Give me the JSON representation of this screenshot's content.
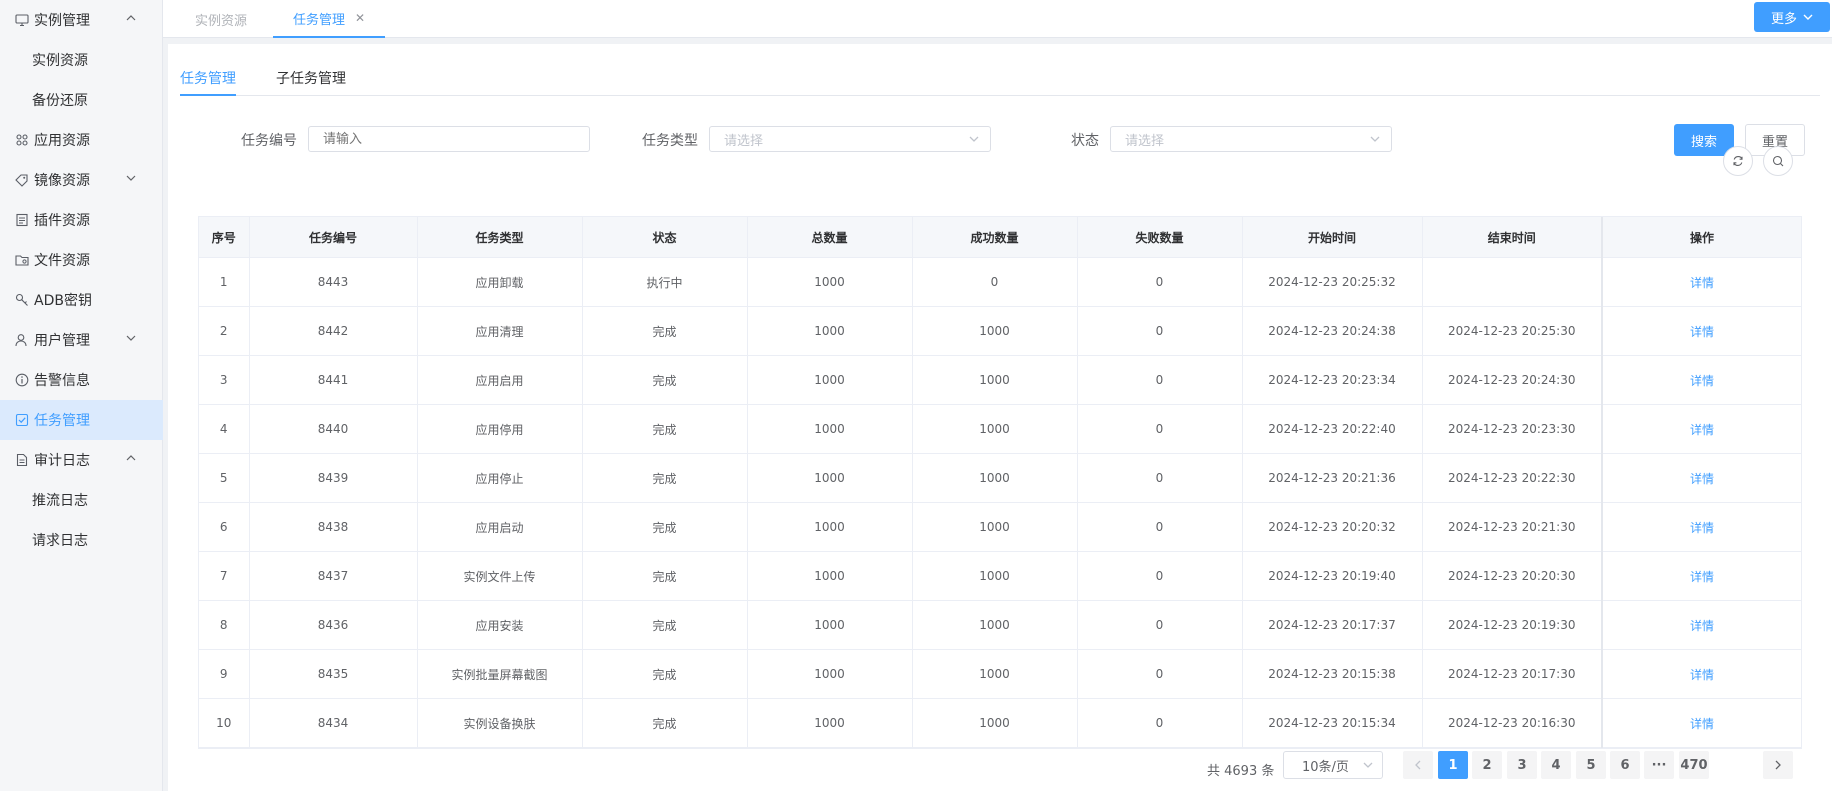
{
  "sidebar": {
    "items": [
      {
        "label": "实例管理",
        "level": "top",
        "icon": "monitor-icon",
        "arrow": "up"
      },
      {
        "label": "实例资源",
        "level": "sub"
      },
      {
        "label": "备份还原",
        "level": "sub"
      },
      {
        "label": "应用资源",
        "level": "top",
        "icon": "apps-grid-icon"
      },
      {
        "label": "镜像资源",
        "level": "top",
        "icon": "tag-icon",
        "arrow": "down"
      },
      {
        "label": "插件资源",
        "level": "top",
        "icon": "document-list-icon"
      },
      {
        "label": "文件资源",
        "level": "top",
        "icon": "folder-icon"
      },
      {
        "label": "ADB密钥",
        "level": "top",
        "icon": "key-icon"
      },
      {
        "label": "用户管理",
        "level": "top",
        "icon": "user-icon",
        "arrow": "down"
      },
      {
        "label": "告警信息",
        "level": "top",
        "icon": "info-icon"
      },
      {
        "label": "任务管理",
        "level": "top",
        "icon": "checkbox-icon",
        "active": true
      },
      {
        "label": "审计日志",
        "level": "top",
        "icon": "file-icon",
        "arrow": "up"
      },
      {
        "label": "推流日志",
        "level": "sub"
      },
      {
        "label": "请求日志",
        "level": "sub"
      }
    ]
  },
  "topbar": {
    "tabs": [
      {
        "label": "实例资源"
      },
      {
        "label": "任务管理",
        "active": true
      }
    ],
    "more_label": "更多"
  },
  "subtabs": [
    "任务管理",
    "子任务管理"
  ],
  "filters": {
    "task_no_label": "任务编号",
    "task_no_placeholder": "请输入",
    "task_type_label": "任务类型",
    "task_type_placeholder": "请选择",
    "status_label": "状态",
    "status_placeholder": "请选择",
    "search_label": "搜索",
    "reset_label": "重置"
  },
  "table": {
    "columns": [
      "序号",
      "任务编号",
      "任务类型",
      "状态",
      "总数量",
      "成功数量",
      "失败数量",
      "开始时间",
      "结束时间",
      "操作"
    ],
    "rows": [
      [
        "1",
        "8443",
        "应用卸载",
        "执行中",
        "1000",
        "0",
        "0",
        "2024-12-23 20:25:32",
        "",
        "详情"
      ],
      [
        "2",
        "8442",
        "应用清理",
        "完成",
        "1000",
        "1000",
        "0",
        "2024-12-23 20:24:38",
        "2024-12-23 20:25:30",
        "详情"
      ],
      [
        "3",
        "8441",
        "应用启用",
        "完成",
        "1000",
        "1000",
        "0",
        "2024-12-23 20:23:34",
        "2024-12-23 20:24:30",
        "详情"
      ],
      [
        "4",
        "8440",
        "应用停用",
        "完成",
        "1000",
        "1000",
        "0",
        "2024-12-23 20:22:40",
        "2024-12-23 20:23:30",
        "详情"
      ],
      [
        "5",
        "8439",
        "应用停止",
        "完成",
        "1000",
        "1000",
        "0",
        "2024-12-23 20:21:36",
        "2024-12-23 20:22:30",
        "详情"
      ],
      [
        "6",
        "8438",
        "应用启动",
        "完成",
        "1000",
        "1000",
        "0",
        "2024-12-23 20:20:32",
        "2024-12-23 20:21:30",
        "详情"
      ],
      [
        "7",
        "8437",
        "实例文件上传",
        "完成",
        "1000",
        "1000",
        "0",
        "2024-12-23 20:19:40",
        "2024-12-23 20:20:30",
        "详情"
      ],
      [
        "8",
        "8436",
        "应用安装",
        "完成",
        "1000",
        "1000",
        "0",
        "2024-12-23 20:17:37",
        "2024-12-23 20:19:30",
        "详情"
      ],
      [
        "9",
        "8435",
        "实例批量屏幕截图",
        "完成",
        "1000",
        "1000",
        "0",
        "2024-12-23 20:15:38",
        "2024-12-23 20:17:30",
        "详情"
      ],
      [
        "10",
        "8434",
        "实例设备换肤",
        "完成",
        "1000",
        "1000",
        "0",
        "2024-12-23 20:15:34",
        "2024-12-23 20:16:30",
        "详情"
      ]
    ]
  },
  "pagination": {
    "total_text": "共 4693 条",
    "page_size": "10条/页",
    "pages": [
      "1",
      "2",
      "3",
      "4",
      "5",
      "6",
      "···",
      "470"
    ],
    "current": "1"
  },
  "colors": {
    "accent": "#409eff",
    "active_menu_bg": "#dbeafd"
  }
}
